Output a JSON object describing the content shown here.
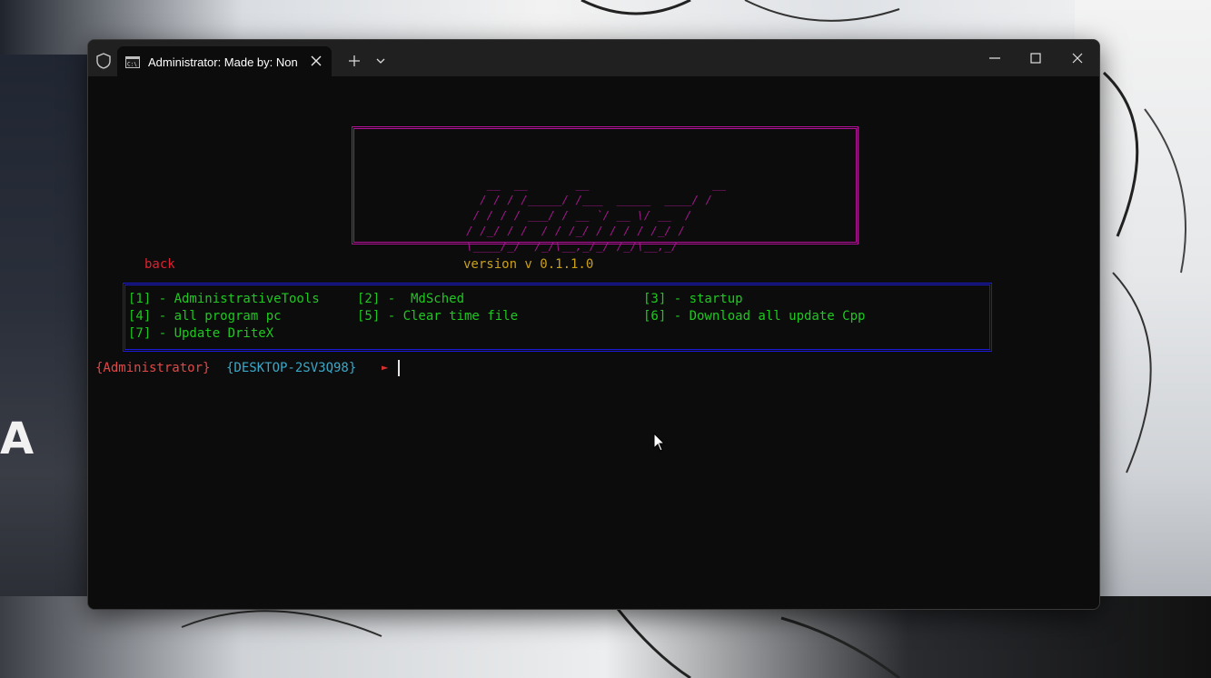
{
  "window": {
    "tab_title": "Administrator:  Made by: Non",
    "icons": {
      "shield": "shield-icon",
      "tab": "command-prompt-icon",
      "tab_close": "close-icon",
      "new_tab": "plus-icon",
      "dropdown": "chevron-down-icon",
      "minimize": "minimize-icon",
      "maximize": "maximize-icon",
      "close": "close-icon"
    }
  },
  "terminal": {
    "logo_art": "       __  __       __                  __\n      / / / /_____/ /___  _____  ____/ /\n     / / / / ___/ / __ `/ __ \\/ __  / \n    / /_/ / /  / / /_/ / / / / /_/ /  \n    \\____/_/  /_/\\__,_/_/ /_/\\__,_/   ",
    "back_label": "back",
    "version": "version v 0.1.1.0",
    "menu": [
      {
        "label": "[1] - AdministrativeTools"
      },
      {
        "label": "[2] -  MdSched"
      },
      {
        "label": "[3] - startup"
      },
      {
        "label": "[4] - all program pc"
      },
      {
        "label": "[5] - Clear time file"
      },
      {
        "label": "[6] - Download all update Cpp"
      },
      {
        "label": "[7] - Update DriteX"
      }
    ],
    "prompt": {
      "user": "{Administrator}",
      "host": "{DESKTOP-2SV3Q98}",
      "arrow": "►"
    }
  },
  "colors": {
    "background": "#0c0c0c",
    "titlebar": "#202020",
    "logo": "#b4109a",
    "back": "#e02030",
    "version": "#c9a018",
    "menu_border": "#1a1ad8",
    "menu_text": "#1fc820",
    "prompt_user": "#e04848",
    "prompt_host": "#3aa8c8"
  },
  "wallpaper": {
    "partial_text": "A"
  }
}
